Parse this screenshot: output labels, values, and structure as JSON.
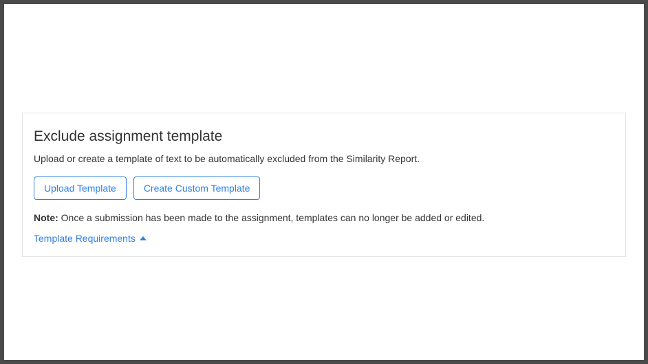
{
  "section": {
    "title": "Exclude assignment template",
    "description": "Upload or create a template of text to be automatically excluded from the Similarity Report.",
    "buttons": {
      "upload": "Upload Template",
      "create": "Create Custom Template"
    },
    "note": {
      "label": "Note:",
      "text": " Once a submission has been made to the assignment, templates can no longer be added or edited."
    },
    "requirements_link": "Template Requirements"
  }
}
